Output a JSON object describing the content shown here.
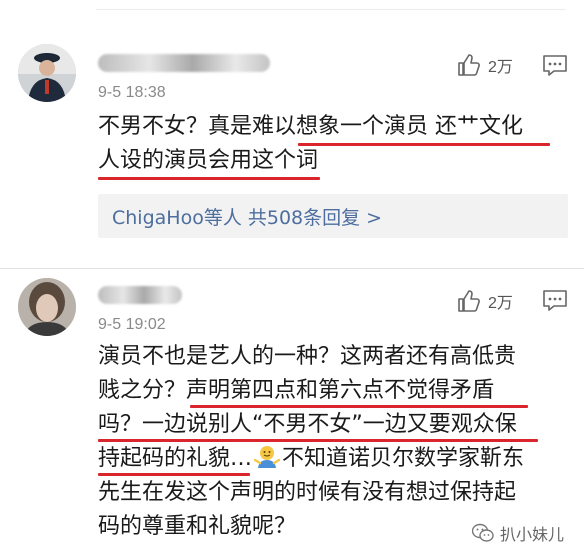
{
  "comments": [
    {
      "time": "9-5 18:38",
      "likes": "2万",
      "lines": [
        "不男不女？真是难以想象一个演员 还艹文化",
        "人设的演员会用这个词"
      ],
      "reply_summary": "ChigaHoo等人 共508条回复 >"
    },
    {
      "time": "9-5 19:02",
      "likes": "2万",
      "lines": [
        "演员不也是艺人的一种？这两者还有高低贵",
        "贱之分？声明第四点和第六点不觉得矛盾",
        "吗？一边说别人“不男不女”一边又要观众保",
        "持起码的礼貌…",
        "先生在发这个声明的时候有没有想过保持起",
        "码的尊重和礼貌呢？"
      ],
      "line4_tail": "不知道诺贝尔数学家靳东"
    }
  ],
  "watermark": "扒小妹儿",
  "colors": {
    "underline": "#d9262d",
    "link": "#4d6e9e",
    "reply_bg": "#f2f2f2"
  },
  "icons": [
    "thumbs-up-icon",
    "comment-icon",
    "shrug-emoji-icon",
    "wechat-logo-icon"
  ]
}
